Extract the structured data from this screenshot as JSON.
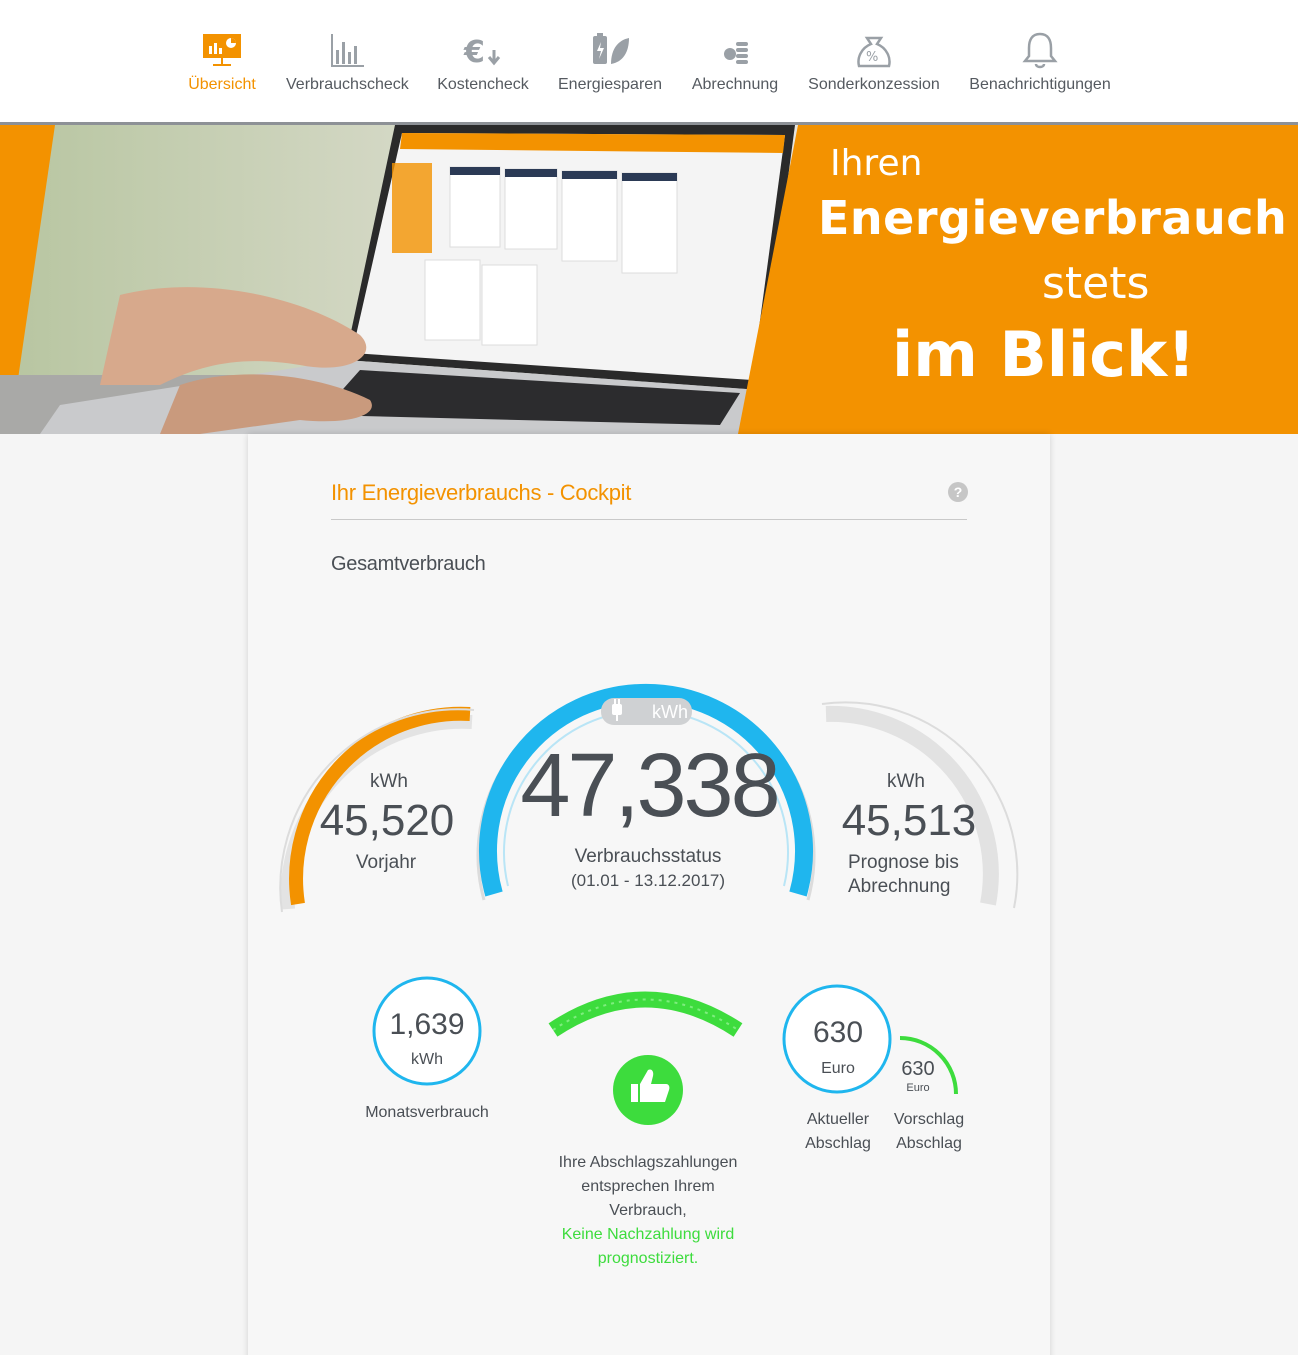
{
  "nav": {
    "items": [
      {
        "label": "Übersicht",
        "icon": "presentation-chart-icon",
        "active": true
      },
      {
        "label": "Verbrauchscheck",
        "icon": "bar-chart-icon",
        "active": false
      },
      {
        "label": "Kostencheck",
        "icon": "euro-down-icon",
        "active": false
      },
      {
        "label": "Energiesparen",
        "icon": "battery-leaf-icon",
        "active": false
      },
      {
        "label": "Abrechnung",
        "icon": "coins-icon",
        "active": false
      },
      {
        "label": "Sonderkonzession",
        "icon": "percent-bag-icon",
        "active": false
      },
      {
        "label": "Benachrichtigungen",
        "icon": "bell-icon",
        "active": false
      }
    ]
  },
  "hero": {
    "line1": "Ihren",
    "line2": "Energieverbrauch",
    "line3": "stets",
    "line4": "im Blick!"
  },
  "cockpit": {
    "title": "Ihr Energieverbrauchs - Cockpit",
    "help": "?",
    "section": "Gesamtverbrauch",
    "left": {
      "unit": "kWh",
      "value": "45,520",
      "label": "Vorjahr"
    },
    "center": {
      "unit": "kWh",
      "value": "47,338",
      "label": "Verbrauchsstatus",
      "period": "(01.01 - 13.12.2017)"
    },
    "right": {
      "unit": "kWh",
      "value": "45,513",
      "label_line1": "Prognose bis",
      "label_line2": "Abrechnung"
    },
    "monthly": {
      "value": "1,639",
      "unit": "kWh",
      "label": "Monatsverbrauch"
    },
    "status": {
      "line1": "Ihre Abschlagszahlungen",
      "line2": "entsprechen Ihrem",
      "line3": "Verbrauch,",
      "line4": "Keine Nachzahlung wird",
      "line5": "prognostiziert."
    },
    "current": {
      "value": "630",
      "unit": "Euro",
      "label_line1": "Aktueller",
      "label_line2": "Abschlag"
    },
    "suggestion": {
      "value": "630",
      "unit": "Euro",
      "label_line1": "Vorschlag",
      "label_line2": "Abschlag"
    }
  },
  "colors": {
    "accent": "#f39200",
    "blue": "#1fb6ee",
    "green": "#3ddc3d",
    "grey": "#e2e2e2",
    "text": "#4a4f55"
  }
}
